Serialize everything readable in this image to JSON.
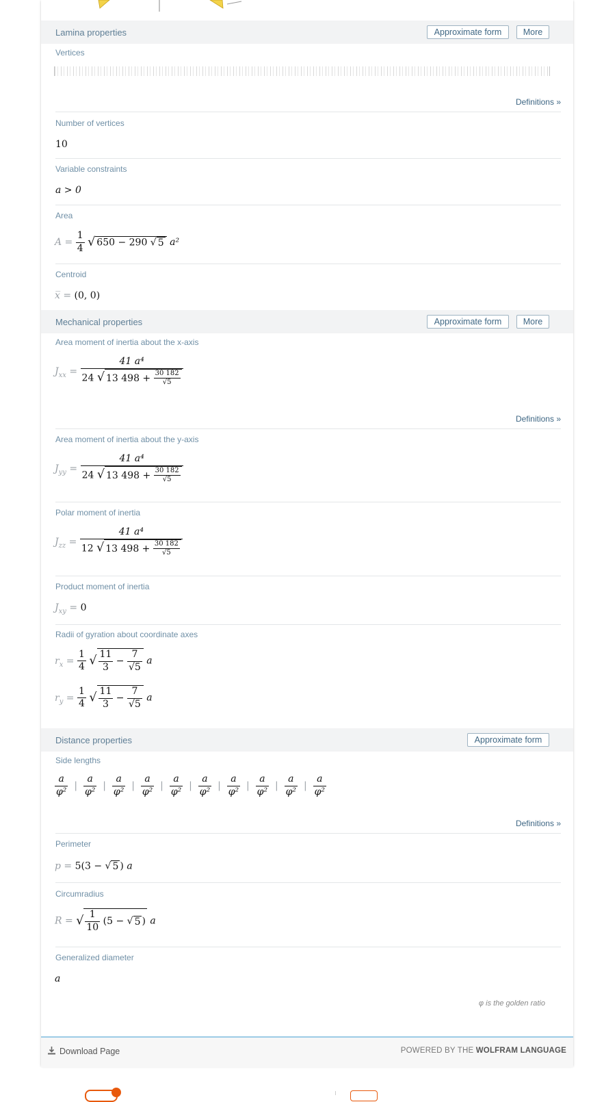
{
  "lamina": {
    "title": "Lamina properties",
    "approx_label": "Approximate form",
    "more_label": "More",
    "vertices_label": "Vertices",
    "definitions_label": "Definitions »",
    "num_vertices_label": "Number of vertices",
    "num_vertices_value": "10",
    "constraints_label": "Variable constraints",
    "constraints_value": "a > 0",
    "area_label": "Area",
    "area_expr": {
      "lhs": "A =",
      "num": "1",
      "den": "4",
      "rad": "650 − 290",
      "inner": "5",
      "tail": "a²"
    },
    "centroid_label": "Centroid",
    "centroid_expr": {
      "lhs": "x̅ =",
      "value": "(0, 0)"
    }
  },
  "mechanical": {
    "title": "Mechanical properties",
    "approx_label": "Approximate form",
    "more_label": "More",
    "jxx_label": "Area moment of inertia about the x-axis",
    "jxx_expr": {
      "lhs": "J",
      "sub": "xx",
      "num": "41 a⁴",
      "coef": "24",
      "rad": "13 498 +",
      "fnum": "30 182",
      "fden": "5"
    },
    "definitions_label": "Definitions »",
    "jyy_label": "Area moment of inertia about the y-axis",
    "jyy_expr": {
      "lhs": "J",
      "sub": "yy",
      "num": "41 a⁴",
      "coef": "24",
      "rad": "13 498 +",
      "fnum": "30 182",
      "fden": "5"
    },
    "polar_label": "Polar moment of inertia",
    "jzz_expr": {
      "lhs": "J",
      "sub": "zz",
      "num": "41 a⁴",
      "coef": "12",
      "rad": "13 498 +",
      "fnum": "30 182",
      "fden": "5"
    },
    "product_label": "Product moment of inertia",
    "jxy_expr": {
      "lhs": "J",
      "sub": "xy",
      "value": "0"
    },
    "gyration_label": "Radii of gyration about coordinate axes",
    "rx_expr": {
      "lhs": "r",
      "sub": "x",
      "num": "1",
      "den": "4",
      "anum": "11",
      "aden": "3",
      "bnum": "7",
      "bden": "5",
      "tail": "a"
    },
    "ry_expr": {
      "lhs": "r",
      "sub": "y",
      "num": "1",
      "den": "4",
      "anum": "11",
      "aden": "3",
      "bnum": "7",
      "bden": "5",
      "tail": "a"
    }
  },
  "distance": {
    "title": "Distance properties",
    "approx_label": "Approximate form",
    "side_label": "Side lengths",
    "side_values": [
      "a/φ²",
      "a/φ²",
      "a/φ²",
      "a/φ²",
      "a/φ²",
      "a/φ²",
      "a/φ²",
      "a/φ²",
      "a/φ²",
      "a/φ²"
    ],
    "side_num": "a",
    "side_den": "φ²",
    "definitions_label": "Definitions »",
    "perimeter_label": "Perimeter",
    "perimeter_expr": {
      "lhs": "p =",
      "a": "5",
      "b": "3 −",
      "c": "5",
      "tail": "a"
    },
    "circumradius_label": "Circumradius",
    "circumradius_expr": {
      "lhs": "R =",
      "fnum": "1",
      "fden": "10",
      "b": "5 −",
      "c": "5",
      "tail": "a"
    },
    "gdiam_label": "Generalized diameter",
    "gdiam_value": "a",
    "golden_note": "φ is the golden ratio"
  },
  "footer": {
    "download_label": "Download Page",
    "powered_prefix": "POWERED BY THE",
    "powered_brand": "WOLFRAM LANGUAGE"
  },
  "colors": {
    "header_bg": "#f2f3f4",
    "label": "#6f8fa6",
    "link": "#3f6784",
    "accent": "#e8590c",
    "footer_line": "#9ccbe6"
  }
}
